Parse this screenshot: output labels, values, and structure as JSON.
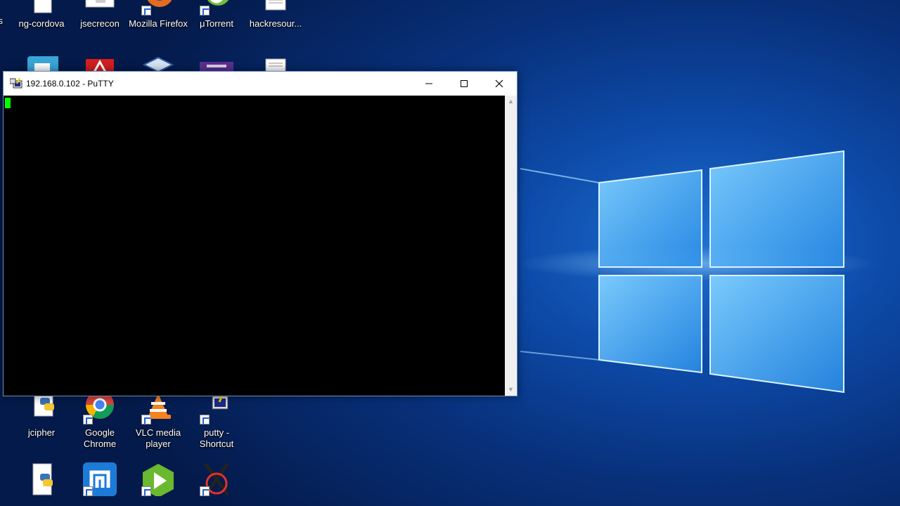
{
  "desktop": {
    "icons_top": [
      {
        "label": "ng-cordova"
      },
      {
        "label": "jsecrecon"
      },
      {
        "label": "Mozilla Firefox"
      },
      {
        "label": "μTorrent"
      },
      {
        "label": "hackresour..."
      }
    ],
    "icons_bottom": [
      {
        "label": "jcipher"
      },
      {
        "label": "Google Chrome"
      },
      {
        "label": "VLC media player"
      },
      {
        "label": "putty - Shortcut"
      }
    ],
    "edge_label": "s"
  },
  "putty": {
    "title": "192.168.0.102 - PuTTY",
    "cursor_color": "#00ff00"
  },
  "colors": {
    "desktop_accent": "#1e6fd1",
    "window_border": "#6c8fc4"
  }
}
